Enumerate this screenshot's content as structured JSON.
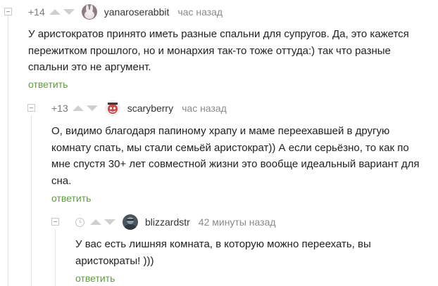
{
  "comments": [
    {
      "rating": "+14",
      "author": "yanaroserabbit",
      "time": "час назад",
      "text": "У аристократов принято иметь разные спальни для супругов. Да, это кажется пережитком прошлого, но и монархия так-то тоже оттуда:) так что разные спальни это не аргумент.",
      "reply_label": "ответить"
    },
    {
      "rating": "+13",
      "author": "scaryberry",
      "time": "час назад",
      "text": "О, видимо благодаря папиному храпу и маме переехавшей в другую комнату спать, мы стали семьёй аристократ)) А если серьёзно, то как по мне спустя 30+ лет совместной жизни это вообще идеальный вариант для сна.",
      "reply_label": "ответить"
    },
    {
      "rating": "",
      "author": "blizzardstr",
      "time": "42 минуты назад",
      "text": "У вас есть лишняя комната, в которую можно переехать, вы аристократы! )))",
      "reply_label": "ответить"
    }
  ],
  "icons": {
    "collapse": "collapse-icon",
    "upvote": "arrow-up-icon",
    "downvote": "arrow-down-icon",
    "pending": "clock-icon"
  },
  "colors": {
    "reply": "#5d9d3e",
    "meta": "#8a8a8a",
    "arrows": "#cfcfcf",
    "thread_line": "#e3e3e3"
  }
}
